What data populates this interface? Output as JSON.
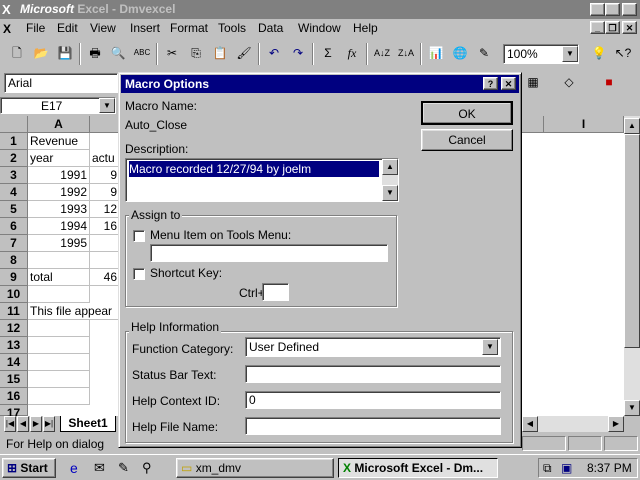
{
  "window": {
    "app_brand": "Microsoft",
    "title_rest": " Excel - Dmvexcel"
  },
  "menu": [
    "File",
    "Edit",
    "View",
    "Insert",
    "Format",
    "Tools",
    "Data",
    "Window",
    "Help"
  ],
  "toolbar": {
    "zoom": "100%"
  },
  "format_bar": {
    "font": "Arial"
  },
  "name_box": "E17",
  "columns": [
    "A",
    "I"
  ],
  "rows": [
    "1",
    "2",
    "3",
    "4",
    "5",
    "6",
    "7",
    "8",
    "9",
    "10",
    "11",
    "12",
    "13",
    "14",
    "15",
    "16",
    "17"
  ],
  "cells": {
    "a1": "Revenue",
    "a2": "year",
    "b2": "actu",
    "a3": "1991",
    "b3": "9",
    "a4": "1992",
    "b4": "9",
    "a5": "1993",
    "b5": "12",
    "a6": "1994",
    "b6": "16",
    "a7": "1995",
    "a9": "total",
    "b9": "46",
    "a11": "This file appear"
  },
  "sheet_tab": "Sheet1",
  "status": "For Help on dialog",
  "taskbar": {
    "start": "Start",
    "task1": "xm_dmv",
    "task2": "Microsoft Excel - Dm...",
    "clock": "8:37 PM"
  },
  "dialog": {
    "title": "Macro Options",
    "macro_name_label": "Macro Name:",
    "macro_name": "Auto_Close",
    "ok": "OK",
    "cancel": "Cancel",
    "description_label": "Description:",
    "description": "Macro recorded 12/27/94 by joelm",
    "assign_to": "Assign to",
    "menu_item_label": "Menu Item on Tools Menu:",
    "shortcut_label": "Shortcut Key:",
    "ctrl_label": "Ctrl+",
    "help_info": "Help Information",
    "function_category_label": "Function Category:",
    "function_category": "User Defined",
    "status_bar_text_label": "Status Bar Text:",
    "help_context_id_label": "Help Context ID:",
    "help_context_id": "0",
    "help_file_name_label": "Help File Name:"
  }
}
